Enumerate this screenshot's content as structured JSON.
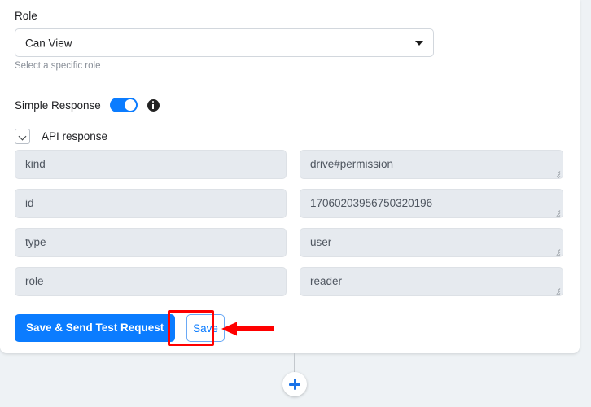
{
  "form": {
    "role_label": "Role",
    "role_value": "Can View",
    "role_helper": "Select a specific role",
    "simple_response_label": "Simple Response",
    "simple_response_enabled": true,
    "api_response_label": "API response",
    "api_response_expanded": true
  },
  "api_response_fields": [
    {
      "key": "kind",
      "value": "drive#permission"
    },
    {
      "key": "id",
      "value": "17060203956750320196"
    },
    {
      "key": "type",
      "value": "user"
    },
    {
      "key": "role",
      "value": "reader"
    }
  ],
  "actions": {
    "primary_label": "Save & Send Test Request",
    "secondary_label": "Save"
  },
  "flow": {
    "add_step_label": "+"
  },
  "colors": {
    "accent_blue": "#0b7cff",
    "annotation_red": "#ff0000",
    "field_background": "#e6eaef",
    "page_background": "#eef2f5",
    "helper_text": "#8a9099"
  }
}
